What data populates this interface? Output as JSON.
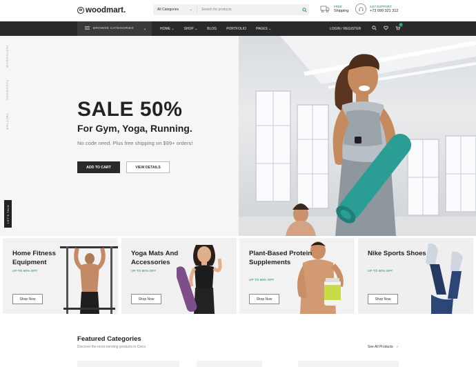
{
  "header": {
    "logo_text": "woodmart.",
    "search_category": "All Categories",
    "search_placeholder": "Search for products",
    "shipping_top": "FREE",
    "shipping_bottom": "Shipping",
    "support_top": "24/7 SUPPORT",
    "support_phone": "+73 099 321 312"
  },
  "nav": {
    "browse_label": "BROWSE CATEGORIES",
    "items": [
      "HOME",
      "SHOP",
      "BLOG",
      "PORTFOLIO",
      "PAGES"
    ],
    "login": "LOGIN / REGISTER",
    "cart_count": "0"
  },
  "social": [
    "INSTAGRAM",
    "FACEBOOK",
    "TWITTER"
  ],
  "talk_label": "LET'S TALK",
  "hero": {
    "headline": "SALE 50%",
    "subheadline": "For Gym, Yoga, Running.",
    "note": "No code need. Plus free shipping on $99+ orders!",
    "primary_button": "ADD TO CART",
    "secondary_button": "VIEW DETAILS"
  },
  "promo_cards": [
    {
      "title": "Home Fitness Equipment",
      "discount": "UP TO 60% OFF",
      "button": "Shop Now"
    },
    {
      "title": "Yoga Mats And Accessories",
      "discount": "UP TO 60% OFF",
      "button": "Shop Now"
    },
    {
      "title": "Plant-Based Protein Supplements",
      "discount": "UP TO 60% OFF",
      "button": "Shop Now"
    },
    {
      "title": "Nike Sports Shoes",
      "discount": "UP TO 60% OFF",
      "button": "Shop Now"
    }
  ],
  "featured": {
    "title": "Featured Categories",
    "subtitle": "Discover the most trending products in Cisco.",
    "see_all": "See All Products"
  },
  "colors": {
    "accent": "#1a8a5e",
    "nav_bg": "#292929",
    "teal_mat": "#2a9d95"
  }
}
